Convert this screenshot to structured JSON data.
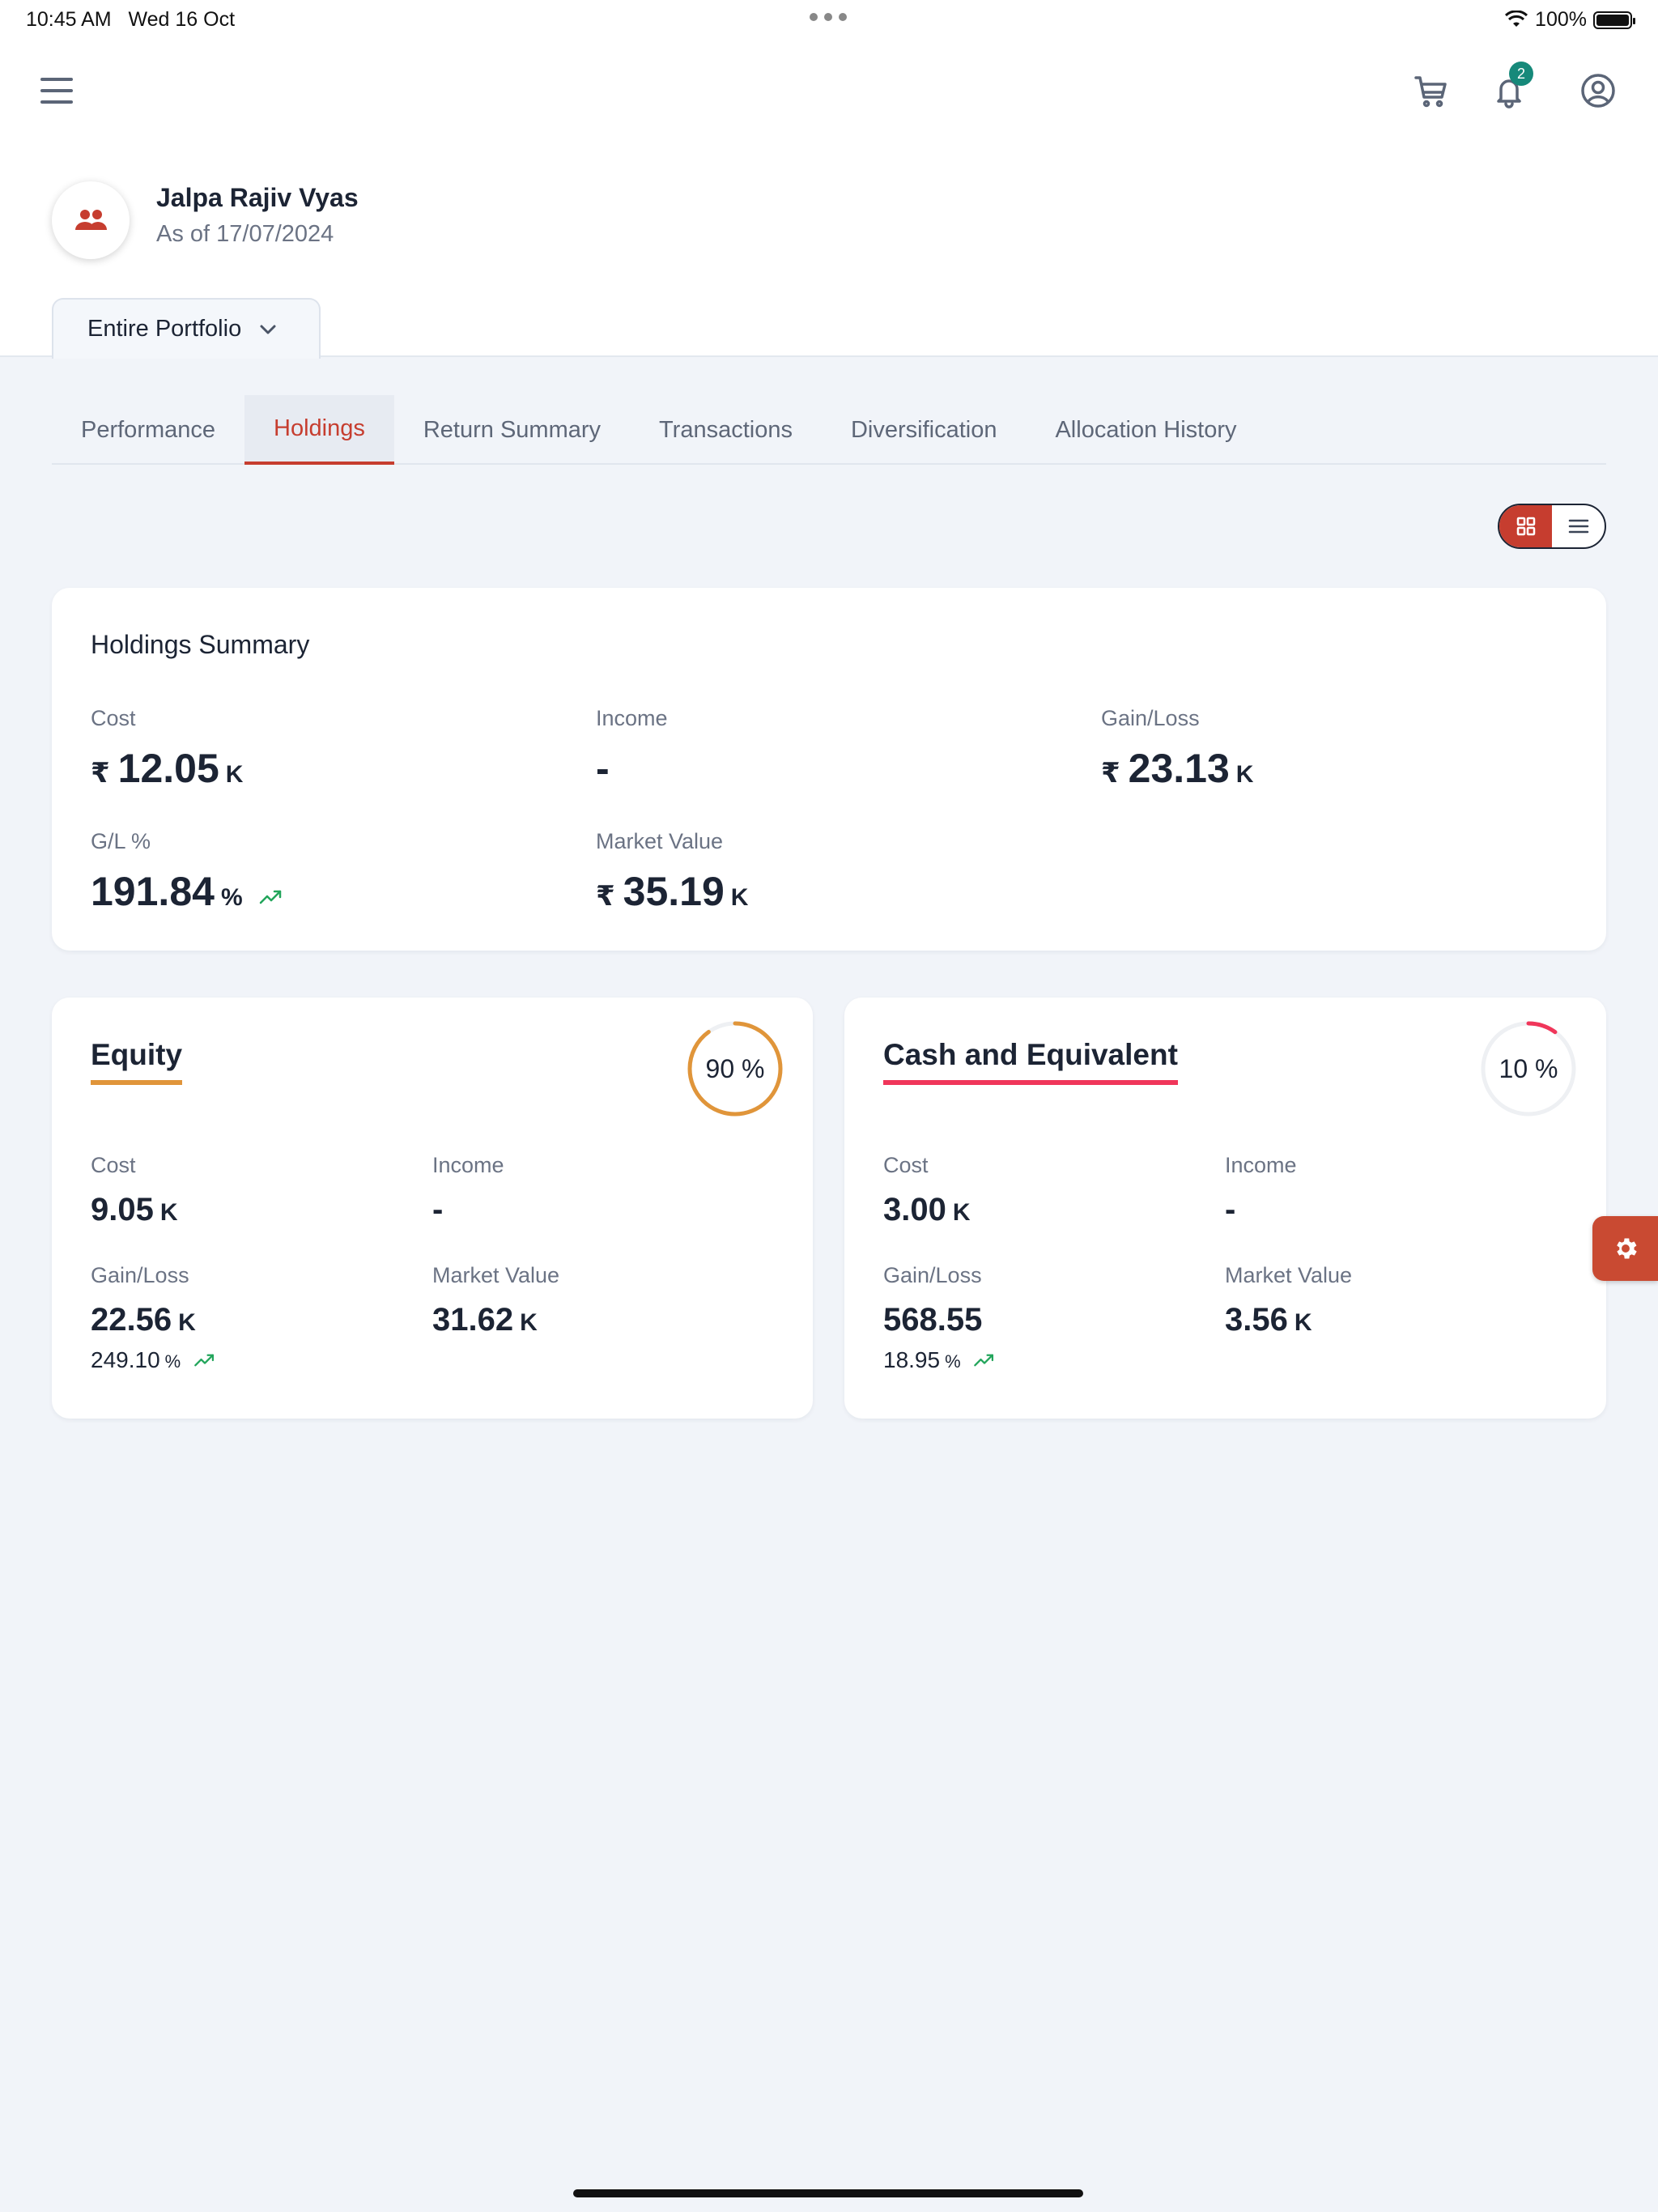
{
  "status_bar": {
    "time": "10:45 AM",
    "date": "Wed 16 Oct",
    "battery": "100%"
  },
  "header": {
    "notification_count": "2"
  },
  "client": {
    "name": "Jalpa Rajiv Vyas",
    "as_of": "As of 17/07/2024"
  },
  "portfolio_selector": {
    "label": "Entire Portfolio"
  },
  "tabs": [
    {
      "label": "Performance"
    },
    {
      "label": "Holdings"
    },
    {
      "label": "Return Summary"
    },
    {
      "label": "Transactions"
    },
    {
      "label": "Diversification"
    },
    {
      "label": "Allocation History"
    }
  ],
  "active_tab": "Holdings",
  "summary": {
    "title": "Holdings Summary",
    "currency_symbol": "₹",
    "cost": {
      "label": "Cost",
      "value": "12.05",
      "unit": "K"
    },
    "income": {
      "label": "Income",
      "value": "-"
    },
    "gain_loss": {
      "label": "Gain/Loss",
      "value": "23.13",
      "unit": "K"
    },
    "gl_pct": {
      "label": "G/L %",
      "value": "191.84",
      "unit": "%"
    },
    "market_value": {
      "label": "Market Value",
      "value": "35.19",
      "unit": "K"
    }
  },
  "equity": {
    "title": "Equity",
    "allocation": {
      "text": "90 %",
      "percent": 90
    },
    "accent": "#e0953a",
    "cost": {
      "label": "Cost",
      "value": "9.05",
      "unit": "K"
    },
    "income": {
      "label": "Income",
      "value": "-"
    },
    "gain_loss": {
      "label": "Gain/Loss",
      "value": "22.56",
      "unit": "K",
      "pct": "249.10",
      "pct_unit": "%"
    },
    "market_value": {
      "label": "Market Value",
      "value": "31.62",
      "unit": "K"
    }
  },
  "cash": {
    "title": "Cash and Equivalent",
    "allocation": {
      "text": "10 %",
      "percent": 10
    },
    "accent": "#f0365a",
    "cost": {
      "label": "Cost",
      "value": "3.00",
      "unit": "K"
    },
    "income": {
      "label": "Income",
      "value": "-"
    },
    "gain_loss": {
      "label": "Gain/Loss",
      "value": "568.55",
      "pct": "18.95",
      "pct_unit": "%"
    },
    "market_value": {
      "label": "Market Value",
      "value": "3.56",
      "unit": "K"
    }
  },
  "colors": {
    "brand": "#c63d2f",
    "positive": "#22a55b",
    "badge": "#16897a"
  }
}
